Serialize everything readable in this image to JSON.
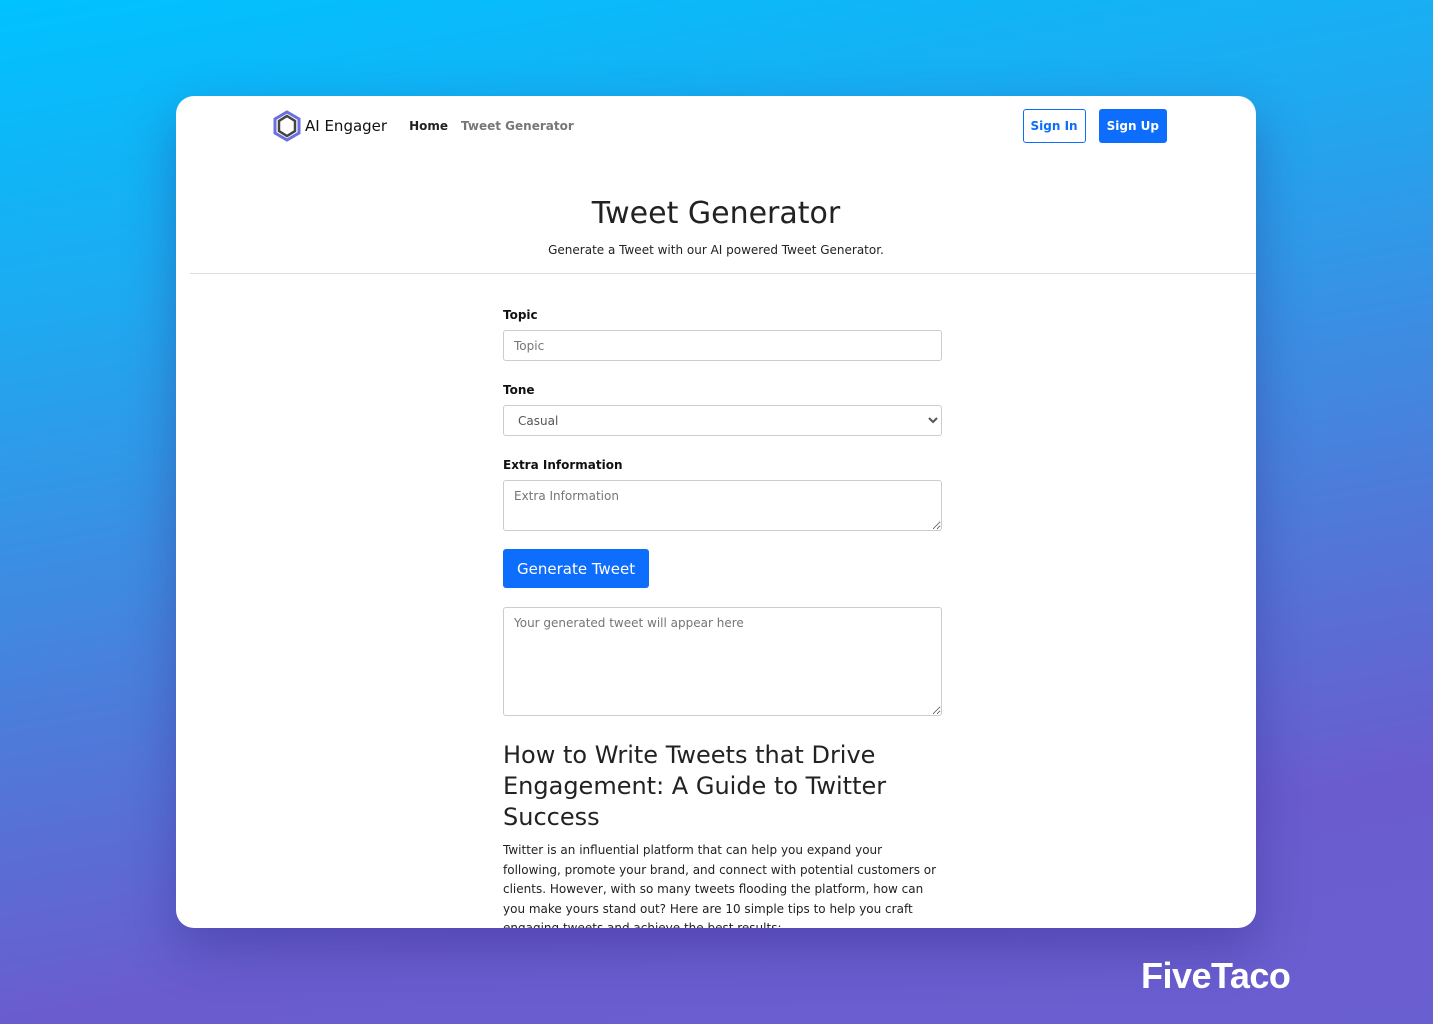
{
  "nav": {
    "brand": "AI Engager",
    "links": [
      "Home",
      "Tweet Generator"
    ],
    "sign_in": "Sign In",
    "sign_up": "Sign Up"
  },
  "hero": {
    "title": "Tweet Generator",
    "subtitle": "Generate a Tweet with our AI powered Tweet Generator."
  },
  "form": {
    "topic_label": "Topic",
    "topic_placeholder": "Topic",
    "tone_label": "Tone",
    "tone_value": "Casual",
    "extra_label": "Extra Information",
    "extra_placeholder": "Extra Information",
    "generate": "Generate Tweet",
    "output_placeholder": "Your generated tweet will appear here"
  },
  "article": {
    "title": "How to Write Tweets that Drive Engagement: A Guide to Twitter Success",
    "body": "Twitter is an influential platform that can help you expand your following, promote your brand, and connect with potential customers or clients. However, with so many tweets flooding the platform, how can you make yours stand out? Here are 10 simple tips to help you craft engaging tweets and achieve the best results:"
  },
  "watermark": "FiveTaco",
  "colors": {
    "primary": "#0d6efd"
  }
}
